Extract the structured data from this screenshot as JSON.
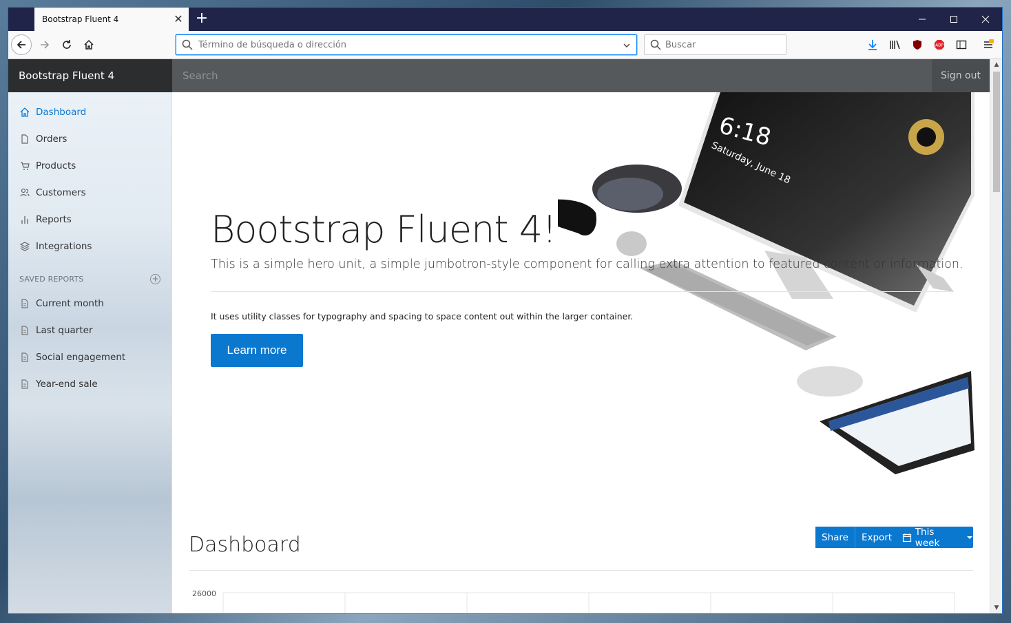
{
  "browser": {
    "tab_title": "Bootstrap Fluent 4",
    "url_placeholder": "Término de búsqueda o dirección",
    "search_placeholder": "Buscar"
  },
  "app": {
    "brand": "Bootstrap Fluent 4",
    "search_placeholder": "Search",
    "signout": "Sign out"
  },
  "sidebar": {
    "items": [
      {
        "label": "Dashboard",
        "icon": "home-icon",
        "active": true
      },
      {
        "label": "Orders",
        "icon": "file-icon"
      },
      {
        "label": "Products",
        "icon": "cart-icon"
      },
      {
        "label": "Customers",
        "icon": "users-icon"
      },
      {
        "label": "Reports",
        "icon": "bar-chart-icon"
      },
      {
        "label": "Integrations",
        "icon": "layers-icon"
      }
    ],
    "saved_heading": "SAVED REPORTS",
    "saved": [
      {
        "label": "Current month",
        "icon": "file-text-icon"
      },
      {
        "label": "Last quarter",
        "icon": "file-text-icon"
      },
      {
        "label": "Social engagement",
        "icon": "file-text-icon"
      },
      {
        "label": "Year-end sale",
        "icon": "file-text-icon"
      }
    ]
  },
  "hero": {
    "title": "Bootstrap Fluent 4!",
    "lead": "This is a simple hero unit, a simple jumbotron-style component for calling extra attention to featured content or information.",
    "body": "It uses utility classes for typography and spacing to space content out within the larger container.",
    "button": "Learn more",
    "device_clock": "6:18",
    "device_date": "Saturday, June 18"
  },
  "dashboard": {
    "title": "Dashboard",
    "share": "Share",
    "export": "Export",
    "range": "This week"
  },
  "chart_data": {
    "type": "line",
    "ytick_top": "26000",
    "x": [],
    "values": []
  },
  "colors": {
    "accent": "#0b78d0",
    "titlebar": "#1f2448",
    "topnav": "#55595c"
  }
}
